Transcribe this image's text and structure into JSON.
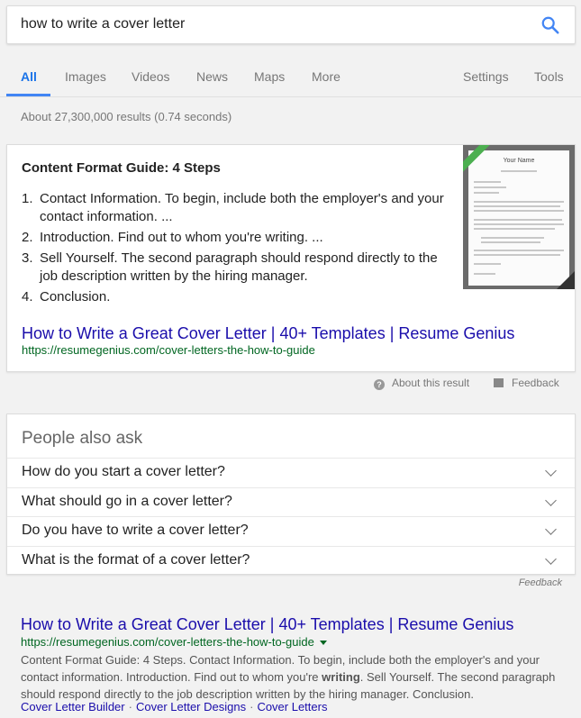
{
  "search": {
    "query": "how to write a cover letter"
  },
  "tabs": [
    {
      "label": "All",
      "active": true
    },
    {
      "label": "Images"
    },
    {
      "label": "Videos"
    },
    {
      "label": "News"
    },
    {
      "label": "Maps"
    },
    {
      "label": "More"
    },
    {
      "label": "Settings"
    },
    {
      "label": "Tools"
    }
  ],
  "result_stats": "About 27,300,000 results (0.74 seconds)",
  "featured_snippet": {
    "heading": "Content Format Guide: 4 Steps",
    "steps": [
      {
        "num": "1.",
        "text": "Contact Information. To begin, include both the employer's and your contact information. ..."
      },
      {
        "num": "2.",
        "text": "Introduction. Find out to whom you're writing. ..."
      },
      {
        "num": "3.",
        "text": "Sell Yourself. The second paragraph should respond directly to the job description written by the hiring manager."
      },
      {
        "num": "4.",
        "text": "Conclusion."
      }
    ],
    "thumbnail_title": "Your Name",
    "link_title": "How to Write a Great Cover Letter | 40+ Templates | Resume Genius",
    "url": "https://resumegenius.com/cover-letters-the-how-to-guide",
    "about_label": "About this result",
    "feedback_label": "Feedback"
  },
  "people_also_ask": {
    "title": "People also ask",
    "questions": [
      "How do you start a cover letter?",
      "What should go in a cover letter?",
      "Do you have to write a cover letter?",
      "What is the format of a cover letter?"
    ],
    "feedback_label": "Feedback"
  },
  "organic_result": {
    "title": "How to Write a Great Cover Letter | 40+ Templates | Resume Genius",
    "url": "https://resumegenius.com/cover-letters-the-how-to-guide",
    "snippet_before": "Content Format Guide: 4 Steps. Contact Information. To begin, include both the employer's and your contact information. Introduction. Find out to whom you're ",
    "snippet_bold": "writing",
    "snippet_after": ". Sell Yourself. The second paragraph should respond directly to the job description written by the hiring manager. Conclusion.",
    "sitelinks": [
      "Cover Letter Builder",
      "Cover Letter Designs",
      "Cover Letters"
    ]
  },
  "colors": {
    "link": "#1a0dab",
    "url": "#006621",
    "accent": "#4285f4"
  }
}
